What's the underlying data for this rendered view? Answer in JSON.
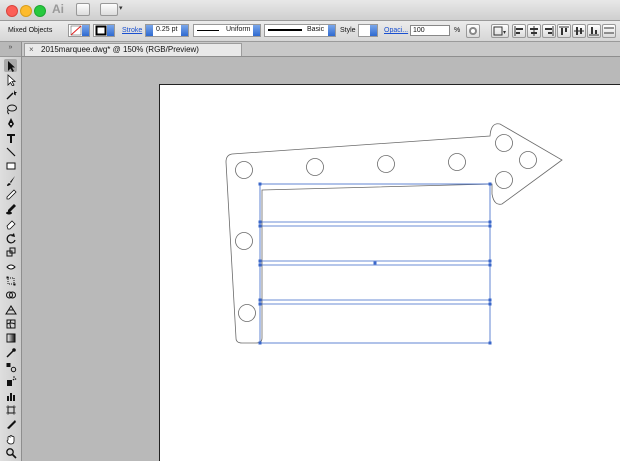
{
  "control_panel": {
    "selection_label": "Mixed Objects",
    "stroke_label": "Stroke",
    "stroke_weight": "0.25 pt",
    "profile_label": "Uniform",
    "brush_label": "Basic",
    "style_label": "Style",
    "opacity_label": "Opaci...",
    "opacity_value": "100",
    "opacity_unit": "%"
  },
  "document_tab": {
    "title": "2015marquee.dwg* @ 150% (RGB/Preview)",
    "close_glyph": "×"
  },
  "tools": [
    "selection-tool",
    "direct-selection-tool",
    "magic-wand-tool",
    "lasso-tool",
    "pen-tool",
    "type-tool",
    "line-segment-tool",
    "rectangle-tool",
    "paintbrush-tool",
    "pencil-tool",
    "blob-brush-tool",
    "eraser-tool",
    "rotate-tool",
    "scale-tool",
    "width-tool",
    "free-transform-tool",
    "shape-builder-tool",
    "perspective-grid-tool",
    "mesh-tool",
    "gradient-tool",
    "eyedropper-tool",
    "blend-tool",
    "symbol-sprayer-tool",
    "column-graph-tool",
    "artboard-tool",
    "slice-tool",
    "hand-tool",
    "zoom-tool"
  ],
  "colors": {
    "selection_blue": "#3a67c9",
    "link_blue": "#1a50d0",
    "artboard": "#ffffff",
    "pasteboard": "#b9b9b9"
  }
}
